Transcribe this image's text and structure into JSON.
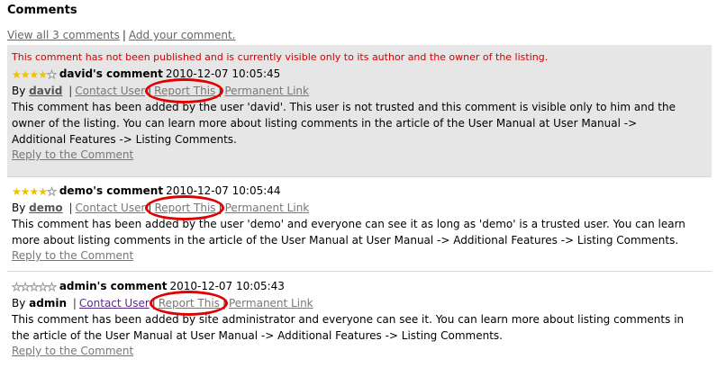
{
  "page": {
    "title": "Comments"
  },
  "toplinks": {
    "view_all": "View all 3 comments",
    "sep": "|",
    "add": "Add your comment."
  },
  "comments": [
    {
      "notice": "This comment has not been published and is currently visible only to its author and the owner of the listing.",
      "rating": 4,
      "title": "david's comment",
      "date": "2010-12-07 10:05:45",
      "by": "By",
      "author": "david",
      "sep": "|",
      "contact": "Contact User",
      "report": "Report This",
      "permalink": "Permanent Link",
      "body": "This comment has been added by the user 'david'. This user is not trusted and this comment is visible only to him and the owner of the listing. You can learn more about listing comments in the article of the User Manual at User Manual -> Additional Features -> Listing Comments.",
      "reply": "Reply to the Comment"
    },
    {
      "rating": 4,
      "title": "demo's comment",
      "date": "2010-12-07 10:05:44",
      "by": "By",
      "author": "demo",
      "sep": "|",
      "contact": "Contact User",
      "report": "Report This",
      "permalink": "Permanent Link",
      "body": "This comment has been added by the user 'demo' and everyone can see it as long as 'demo' is a trusted user. You can learn more about listing comments in the article of the User Manual at User Manual -> Additional Features -> Listing Comments.",
      "reply": "Reply to the Comment"
    },
    {
      "rating": 0,
      "title": "admin's comment",
      "date": "2010-12-07 10:05:43",
      "by": "By",
      "author": "admin",
      "sep": "|",
      "contact": "Contact User",
      "report": "Report This",
      "permalink": "Permanent Link",
      "body": "This comment has been added by site administrator and everyone can see it. You can learn more about listing comments in the article of the User Manual at User Manual -> Additional Features -> Listing Comments.",
      "reply": "Reply to the Comment"
    }
  ],
  "colors": {
    "notice": "#d00000",
    "highlight_ring": "#e00000",
    "star": "#f0c000",
    "pending_bg": "#e6e6e6"
  }
}
